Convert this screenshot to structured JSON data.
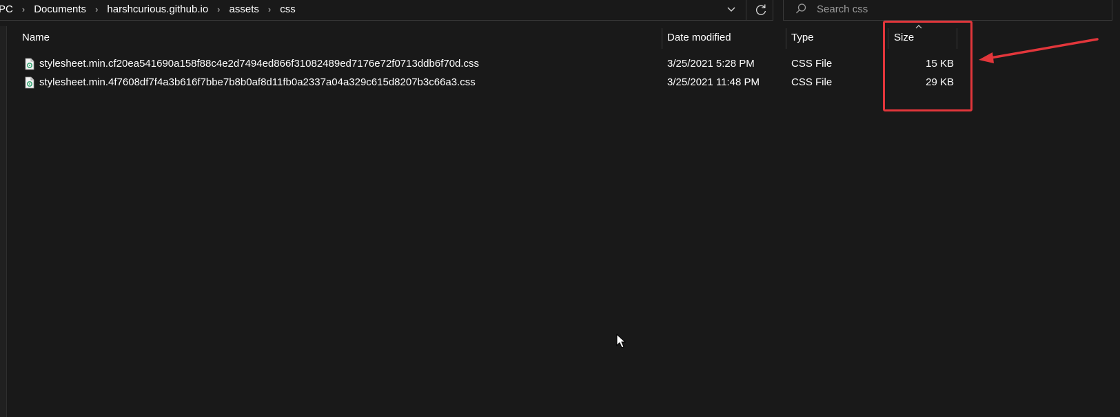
{
  "breadcrumb": [
    "PC",
    "Documents",
    "harshcurious.github.io",
    "assets",
    "css"
  ],
  "search": {
    "placeholder": "Search css",
    "value": ""
  },
  "columns": {
    "name": "Name",
    "date_modified": "Date modified",
    "type": "Type",
    "size": "Size",
    "sort_column": "size",
    "sort_direction": "ascending"
  },
  "files": [
    {
      "name": "stylesheet.min.cf20ea541690a158f88c4e2d7494ed866f31082489ed7176e72f0713ddb6f70d.css",
      "date_modified": "3/25/2021 5:28 PM",
      "type": "CSS File",
      "size": "15 KB",
      "icon": "css-file-icon"
    },
    {
      "name": "stylesheet.min.4f7608df7f4a3b616f7bbe7b8b0af8d11fb0a2337a04a329c615d8207b3c66a3.css",
      "date_modified": "3/25/2021 11:48 PM",
      "type": "CSS File",
      "size": "29 KB",
      "icon": "css-file-icon"
    }
  ],
  "colors": {
    "background": "#191919",
    "text": "#ffffff",
    "annotation": "#e2363b",
    "file_icon_accent": "#3aa776"
  }
}
